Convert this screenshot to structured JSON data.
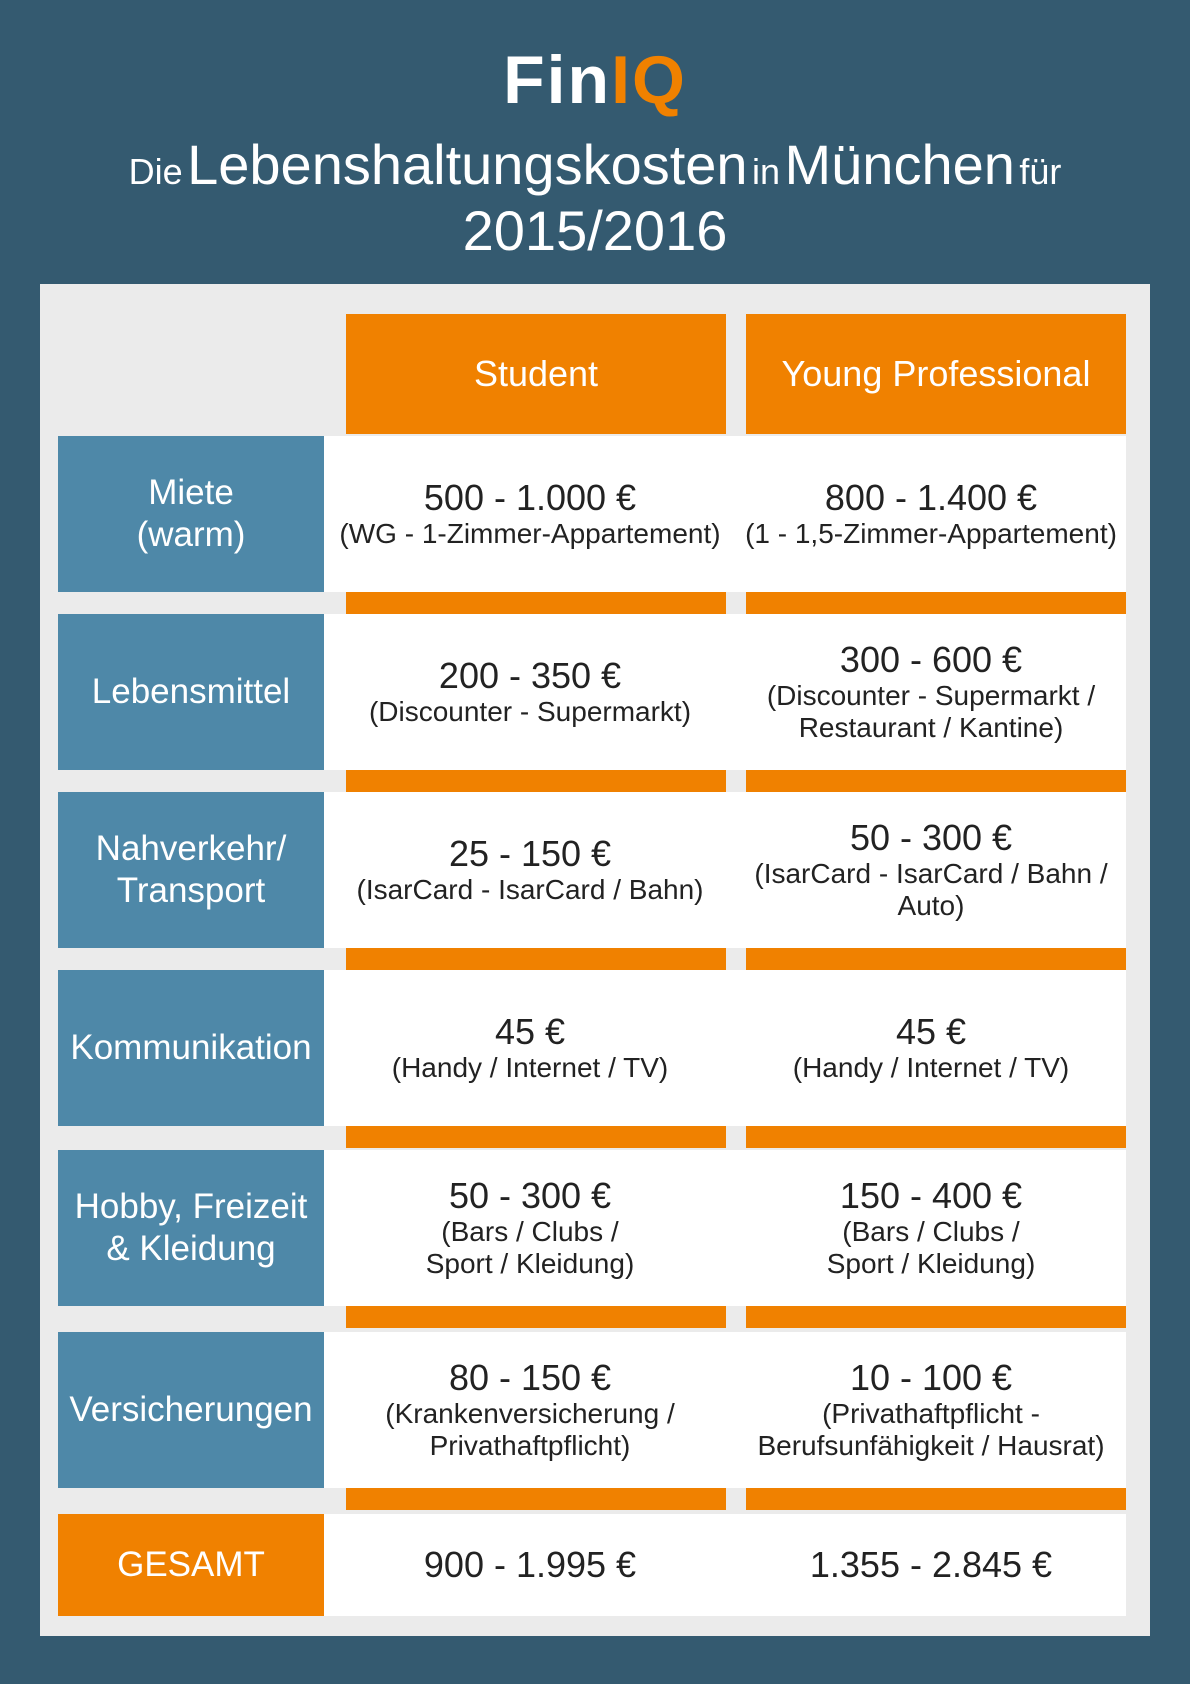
{
  "logo": {
    "fin": "Fin",
    "iq": "IQ"
  },
  "title": {
    "part1": "Die",
    "part2": "Lebenshaltungskosten",
    "part3": "in",
    "part4": "München",
    "part5": "für",
    "year": "2015/2016"
  },
  "columns": {
    "student": "Student",
    "professional": "Young Professional"
  },
  "rows": [
    {
      "label": "Miete\n(warm)",
      "student": {
        "amount": "500 - 1.000 €",
        "desc": "(WG - 1-Zimmer-Appartement)"
      },
      "professional": {
        "amount": "800 - 1.400 €",
        "desc": "(1 - 1,5-Zimmer-Appartement)"
      }
    },
    {
      "label": "Lebensmittel",
      "student": {
        "amount": "200 - 350 €",
        "desc": "(Discounter - Supermarkt)"
      },
      "professional": {
        "amount": "300 - 600 €",
        "desc": "(Discounter - Supermarkt /\nRestaurant / Kantine)"
      }
    },
    {
      "label": "Nahverkehr/\nTransport",
      "student": {
        "amount": "25 - 150 €",
        "desc": "(IsarCard - IsarCard / Bahn)"
      },
      "professional": {
        "amount": "50 - 300 €",
        "desc": "(IsarCard - IsarCard / Bahn /\nAuto)"
      }
    },
    {
      "label": "Kommunikation",
      "student": {
        "amount": "45 €",
        "desc": "(Handy / Internet / TV)"
      },
      "professional": {
        "amount": "45 €",
        "desc": "(Handy / Internet / TV)"
      }
    },
    {
      "label": "Hobby, Freizeit\n& Kleidung",
      "student": {
        "amount": "50 - 300 €",
        "desc": "(Bars / Clubs /\nSport / Kleidung)"
      },
      "professional": {
        "amount": "150 - 400 €",
        "desc": "(Bars / Clubs /\nSport / Kleidung)"
      }
    },
    {
      "label": "Versicherungen",
      "student": {
        "amount": "80 - 150 €",
        "desc": "(Krankenversicherung /\nPrivathaftpflicht)"
      },
      "professional": {
        "amount": "10 - 100 €",
        "desc": "(Privathaftpflicht -\nBerufsunfähigkeit / Hausrat)"
      }
    }
  ],
  "total": {
    "label": "GESAMT",
    "student": "900 - 1.995 €",
    "professional": "1.355 - 2.845 €"
  },
  "colors": {
    "background": "#345a70",
    "orange": "#f08100",
    "blue": "#4e88a8",
    "panel": "#ebebeb"
  }
}
